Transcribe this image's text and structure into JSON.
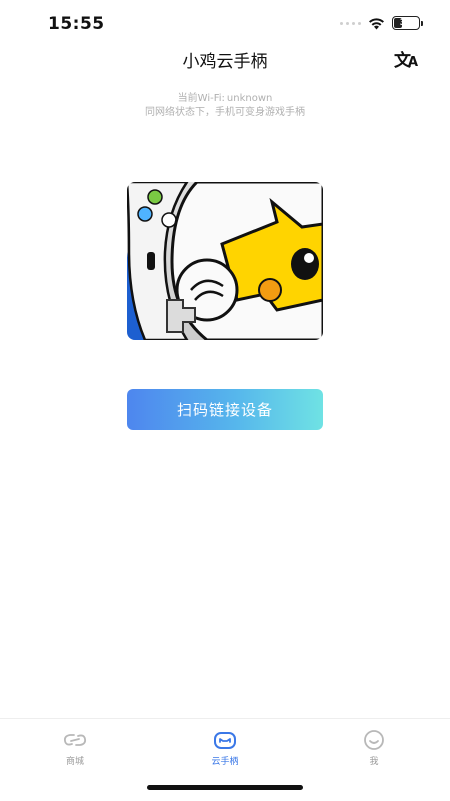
{
  "status_bar": {
    "time": "15:55",
    "battery_level": "38",
    "battery_fraction": 0.38
  },
  "header": {
    "title": "小鸡云手柄",
    "language_icon": "translate-icon",
    "language_main_glyph": "文",
    "language_sub_glyph": "A"
  },
  "wifi_info": {
    "current_label": "当前Wi-Fi:",
    "current_value": "unknown",
    "description": "同网络状态下，手机可变身游戏手柄"
  },
  "main": {
    "image_subject": "chick-mascot-controller",
    "scan_button_label": "扫码链接设备",
    "button_gradient": [
      "#4e86ee",
      "#56b6ec",
      "#6fe2e4"
    ]
  },
  "tab_bar": {
    "accent_color": "#3b78e7",
    "items": [
      {
        "label": "商城",
        "icon": "mall-icon",
        "active": false
      },
      {
        "label": "云手柄",
        "icon": "gamepad-icon",
        "active": true
      },
      {
        "label": "我",
        "icon": "profile-smile-icon",
        "active": false
      }
    ]
  }
}
